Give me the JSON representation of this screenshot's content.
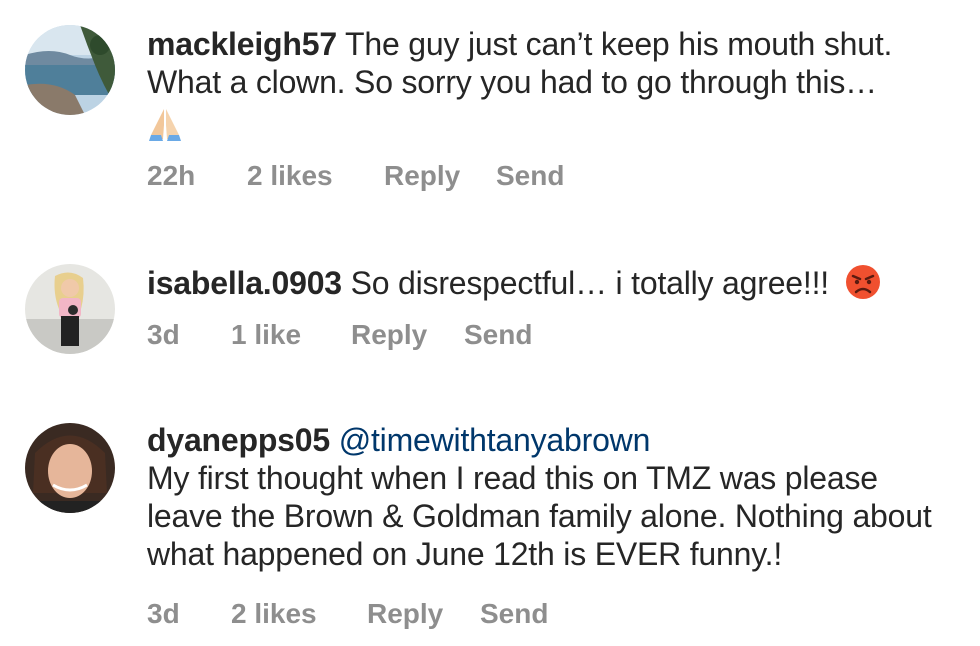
{
  "comments": [
    {
      "username": "mackleigh57",
      "mention": "",
      "text": "The guy just can’t keep his mouth shut. What a clown. So sorry you had to go through this…",
      "emoji": "folded-hands",
      "time": "22h",
      "likes": "2 likes",
      "reply": "Reply",
      "send": "Send"
    },
    {
      "username": "isabella.0903",
      "mention": "",
      "text": "So disrespectful… i totally agree!!!",
      "emoji": "angry-face",
      "time": "3d",
      "likes": "1 like",
      "reply": "Reply",
      "send": "Send"
    },
    {
      "username": "dyanepps05",
      "mention": "@timewithtanyabrown",
      "text": "My first thought when I read this on TMZ was please leave the Brown & Goldman family alone.  Nothing about what happened on June 12th is EVER funny.!",
      "emoji": "",
      "time": "3d",
      "likes": "2 likes",
      "reply": "Reply",
      "send": "Send"
    }
  ],
  "colors": {
    "text": "#262626",
    "meta": "#8e8e8e",
    "mention": "#00376b"
  }
}
